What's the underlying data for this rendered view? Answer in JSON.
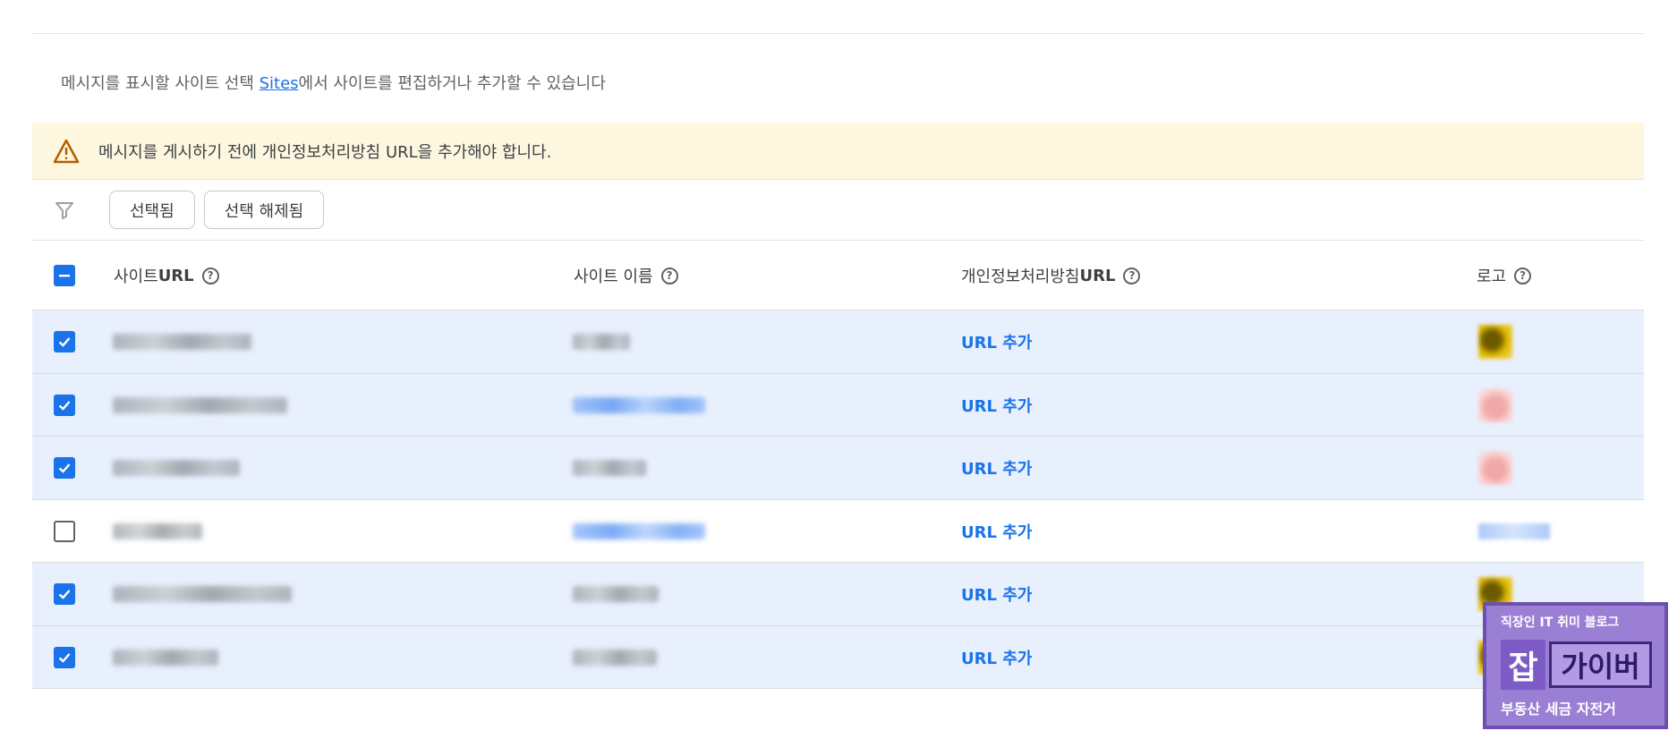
{
  "intro": {
    "prefix": "메시지를 표시할 사이트 선택 ",
    "link": "Sites",
    "suffix": "에서 사이트를 편집하거나 추가할 수 있습니다"
  },
  "banner": {
    "icon": "warning-triangle-icon",
    "text": "메시지를 게시하기 전에 개인정보처리방침 URL을 추가해야 합니다."
  },
  "filters": {
    "icon": "filter-icon",
    "chips": [
      "선택됨",
      "선택 해제됨"
    ]
  },
  "table": {
    "header_checkbox": "partial",
    "columns": {
      "site_url": {
        "prefix": "사이트 ",
        "bold": "URL"
      },
      "site_name": {
        "prefix": "사이트 이름",
        "bold": ""
      },
      "privacy_url": {
        "prefix": "개인정보처리방침 ",
        "bold": "URL"
      },
      "logo": {
        "prefix": "로고",
        "bold": ""
      }
    },
    "help_glyph": "?",
    "rows": [
      {
        "checked": true,
        "privacy_action": "URL 추가",
        "logo": "gold"
      },
      {
        "checked": true,
        "privacy_action": "URL 추가",
        "logo": "red"
      },
      {
        "checked": true,
        "privacy_action": "URL 추가",
        "logo": "red"
      },
      {
        "checked": false,
        "privacy_action": "URL 추가",
        "logo": "bluetext"
      },
      {
        "checked": true,
        "privacy_action": "URL 추가",
        "logo": "gold"
      },
      {
        "checked": true,
        "privacy_action": "URL 추가",
        "logo": "gold"
      }
    ]
  },
  "watermark": {
    "line1": "직장인 IT 취미 블로그",
    "badge": "잡",
    "name": "가이버",
    "line3": "부동산 세금 자전거"
  },
  "colors": {
    "accent": "#1a73e8",
    "selected_row": "#e8f0fe",
    "banner_bg": "#fef7e0",
    "warning": "#b06000"
  }
}
